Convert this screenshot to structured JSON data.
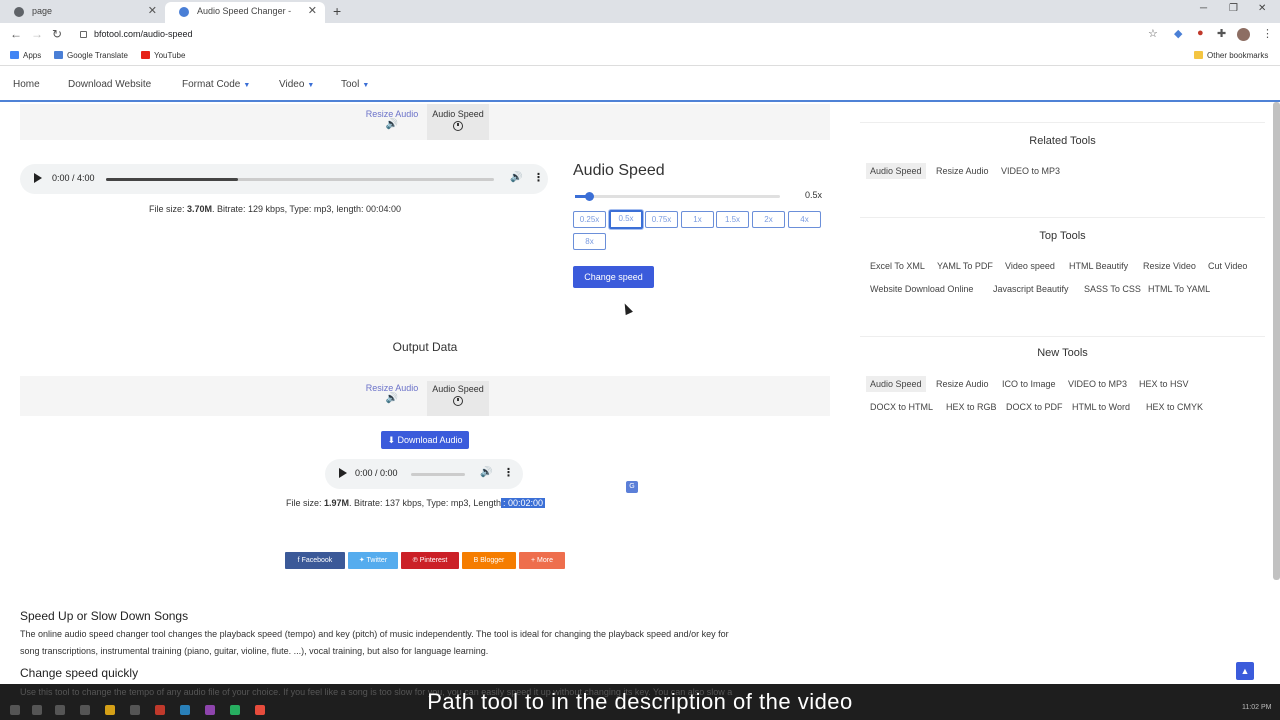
{
  "browser": {
    "tabs": [
      {
        "label": "page"
      },
      {
        "label": "Audio Speed Changer - Speed U"
      }
    ],
    "url": "bfotool.com/audio-speed",
    "bookmarks": [
      "Apps",
      "Google Translate",
      "YouTube"
    ],
    "other_bookmarks": "Other bookmarks"
  },
  "nav": {
    "items": [
      "Home",
      "Download Website",
      "Format Code",
      "Video",
      "Tool"
    ]
  },
  "input_section": {
    "tool_tabs": {
      "resize": "Resize Audio",
      "speed": "Audio Speed"
    },
    "player": {
      "time": "0:00 / 4:00",
      "progress": 0.34
    },
    "file_info": {
      "prefix": "File size: ",
      "size": "3.70M",
      "rest": ". Bitrate: 129 kbps, Type: mp3, length: 00:04:00"
    },
    "speed": {
      "title": "Audio Speed",
      "value_label": "0.5x",
      "slider_fraction": 0.07,
      "options": [
        "0.25x",
        "0.5x",
        "0.75x",
        "1x",
        "1.5x",
        "2x",
        "4x",
        "8x"
      ],
      "selected": "0.5x",
      "button": "Change speed"
    }
  },
  "output_section": {
    "title": "Output Data",
    "tool_tabs": {
      "resize": "Resize Audio",
      "speed": "Audio Speed"
    },
    "download_button": "Download Audio",
    "player": {
      "time": "0:00 / 0:00"
    },
    "file_info": {
      "prefix": "File size: ",
      "size": "1.97M",
      "rest": ". Bitrate: 137 kbps, Type: mp3, Length",
      "highlight": ": 00:02:00"
    }
  },
  "share": [
    {
      "label": "Facebook",
      "color": "#3b5998"
    },
    {
      "label": "Twitter",
      "color": "#55acee"
    },
    {
      "label": "Pinterest",
      "color": "#cb2027"
    },
    {
      "label": "Blogger",
      "color": "#f57d00"
    },
    {
      "label": "More",
      "color": "#ee6e4d"
    }
  ],
  "article": {
    "heading1": "Speed Up or Slow Down Songs",
    "para1_line1": "The online audio speed changer tool changes the playback speed (tempo) and key (pitch) of music independently. The tool is ideal for changing the playback speed and/or key for",
    "para1_line2": "song transcriptions, instrumental training (piano, guitar, violine, flute. ...), vocal training, but also for language learning.",
    "heading2": "Change speed quickly",
    "para2": "Use this tool to change the tempo of any audio file of your choice. If you feel like a song is too slow for you, you can easily speed it up without changing its key. You can also slow a"
  },
  "sidebar": {
    "related": {
      "title": "Related Tools",
      "items": [
        "Audio Speed",
        "Resize Audio",
        "VIDEO to MP3"
      ]
    },
    "top": {
      "title": "Top Tools",
      "row1": [
        "Excel To XML",
        "YAML To PDF",
        "Video speed",
        "HTML Beautify",
        "Resize Video",
        "Cut Video"
      ],
      "row2": [
        "Website Download Online",
        "Javascript Beautify",
        "SASS To CSS",
        "HTML To YAML"
      ]
    },
    "new": {
      "title": "New Tools",
      "row1": [
        "Audio Speed",
        "Resize Audio",
        "ICO to Image",
        "VIDEO to MP3",
        "HEX to HSV"
      ],
      "row2": [
        "DOCX to HTML",
        "HEX to RGB",
        "DOCX to PDF",
        "HTML to Word",
        "HEX to CMYK"
      ]
    }
  },
  "caption": "Path tool to in the description of the video",
  "clock": "11:02 PM",
  "colors": {
    "accent": "#3b5bdb",
    "link": "#6b72c9"
  }
}
